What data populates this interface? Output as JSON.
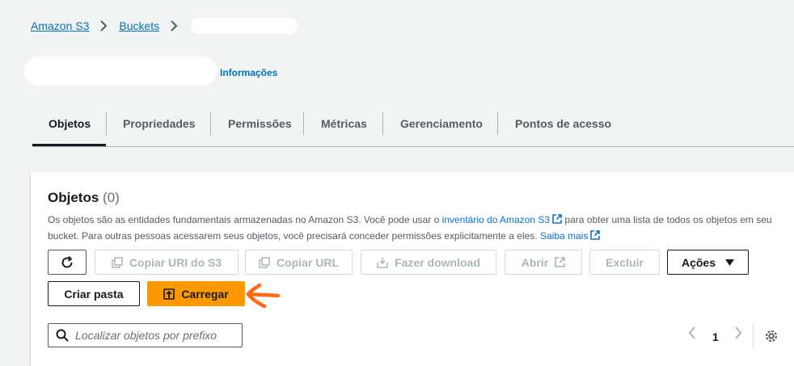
{
  "breadcrumb": {
    "items": [
      "Amazon S3",
      "Buckets"
    ],
    "current": ""
  },
  "header": {
    "info_link": "Informações"
  },
  "tabs": [
    "Objetos",
    "Propriedades",
    "Permissões",
    "Métricas",
    "Gerenciamento",
    "Pontos de acesso"
  ],
  "active_tab": "Objetos",
  "objects": {
    "title": "Objetos",
    "count": "(0)",
    "desc_part1": "Os objetos são as entidades fundamentais armazenadas no Amazon S3. Você pode usar o ",
    "inventory_link": "inventário do Amazon S3",
    "desc_part2": " para obter uma lista de todos os objetos em seu bucket. Para outras pessoas acessarem seus objetos, você precisará conceder permissões explicitamente a eles. ",
    "learn_more_link": "Saiba mais"
  },
  "toolbar": {
    "refresh_icon": "refresh-icon",
    "copy_uri": "Copiar URI do S3",
    "copy_url": "Copiar URL",
    "download": "Fazer download",
    "open": "Abrir",
    "delete": "Excluir",
    "actions": "Ações",
    "create_folder": "Criar pasta",
    "upload": "Carregar"
  },
  "search": {
    "placeholder": "Localizar objetos por prefixo",
    "value": ""
  },
  "pagination": {
    "page": "1"
  },
  "colors": {
    "link": "#0073bb",
    "primary": "#ff9900",
    "annotation_arrow": "#ff6a13"
  }
}
